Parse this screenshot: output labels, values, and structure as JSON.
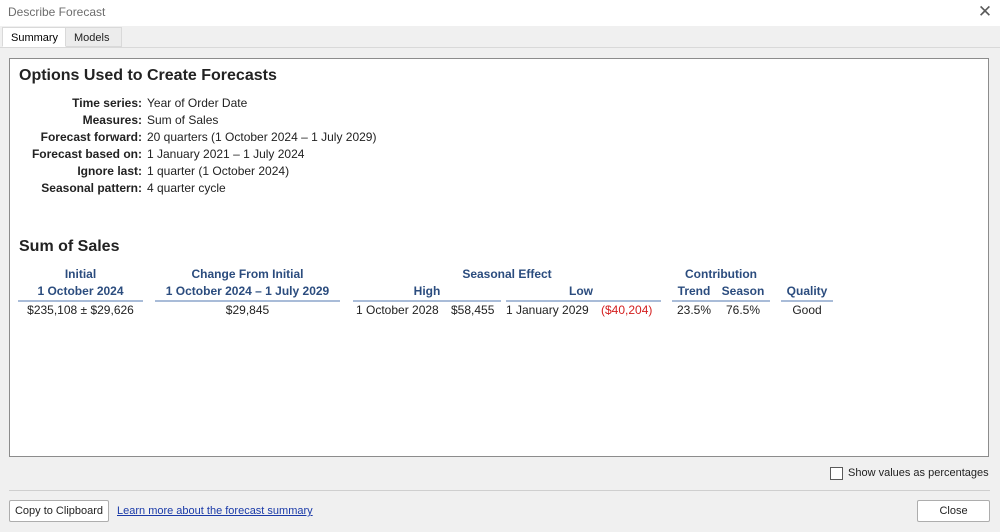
{
  "window": {
    "title": "Describe Forecast"
  },
  "tabs": [
    {
      "label": "Summary"
    },
    {
      "label": "Models"
    }
  ],
  "options": {
    "heading": "Options Used to Create Forecasts",
    "rows": [
      {
        "label": "Time series:",
        "value": "Year of Order Date"
      },
      {
        "label": "Measures:",
        "value": "Sum of Sales"
      },
      {
        "label": "Forecast forward:",
        "value": "20 quarters (1 October 2024 – 1 July 2029)"
      },
      {
        "label": "Forecast based on:",
        "value": "1 January 2021 – 1 July 2024"
      },
      {
        "label": "Ignore last:",
        "value": "1 quarter (1 October 2024)"
      },
      {
        "label": "Seasonal pattern:",
        "value": "4 quarter cycle"
      }
    ]
  },
  "summary": {
    "heading": "Sum of Sales",
    "initial": {
      "header": "Initial",
      "subheader": "1 October 2024",
      "value": "$235,108 ± $29,626"
    },
    "change": {
      "header": "Change From Initial",
      "subheader": "1 October 2024 – 1 July 2029",
      "value": "$29,845"
    },
    "seasonal": {
      "header": "Seasonal Effect",
      "high_label": "High",
      "low_label": "Low",
      "high_date": "1 October 2028",
      "high_value": "$58,455",
      "low_date": "1 January 2029",
      "low_value": "($40,204)"
    },
    "contribution": {
      "header": "Contribution",
      "trend_label": "Trend",
      "season_label": "Season",
      "trend_value": "23.5%",
      "season_value": "76.5%"
    },
    "quality": {
      "header": "Quality",
      "value": "Good"
    }
  },
  "footer": {
    "checkbox_label": "Show values as percentages",
    "copy_button": "Copy to Clipboard",
    "learn_link": "Learn more about the forecast summary",
    "close_button": "Close"
  },
  "colors": {
    "header_text": "#2b4c7e",
    "underline": "#a9bcd8",
    "negative": "#d42020"
  },
  "icons": {
    "close": "close-icon"
  }
}
